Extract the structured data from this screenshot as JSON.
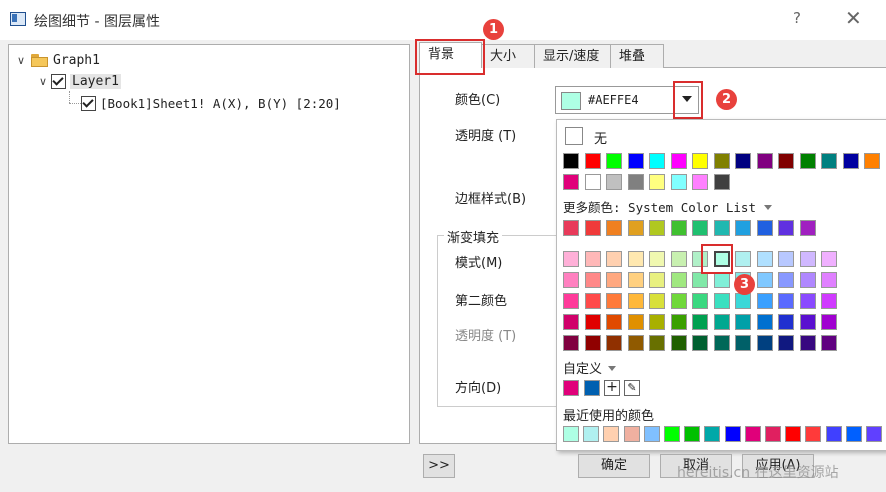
{
  "window": {
    "title": "绘图细节 - 图层属性",
    "help": "?",
    "close": "✕"
  },
  "tree": {
    "items": [
      {
        "label": "Graph1"
      },
      {
        "label": "Layer1"
      },
      {
        "label": "[Book1]Sheet1! A(X), B(Y) [2:20]"
      }
    ]
  },
  "tabs": [
    "背景",
    "大小",
    "显示/速度",
    "堆叠"
  ],
  "panel": {
    "color_label": "颜色(C)",
    "transparency_label": "透明度 (T)",
    "border_label": "边框样式(B)",
    "gradient_group": "渐变填充",
    "mode_label": "模式(M)",
    "second_color_label": "第二颜色",
    "gradient_transparency_label": "透明度 (T)",
    "direction_label": "方向(D)"
  },
  "color_combo": {
    "value": "#AEFFE4",
    "swatch_color": "#AEFFE4"
  },
  "popup": {
    "none_label": "无",
    "more_colors_label": "更多颜色: System Color List",
    "custom_label": "自定义",
    "recent_label": "最近使用的颜色",
    "basic_row1": [
      "#000000",
      "#ff0000",
      "#00ff00",
      "#0000ff",
      "#00ffff",
      "#ff00ff",
      "#ffff00",
      "#808000",
      "#000080",
      "#800080",
      "#800000",
      "#008000",
      "#008080",
      "#0000a0",
      "#ff8000",
      "#8000ff"
    ],
    "basic_row2": [
      "#e0007a",
      "#ffffff",
      "#c0c0c0",
      "#808080",
      "#ffff80",
      "#80ffff",
      "#ff80ff",
      "#404040"
    ],
    "system_row": [
      "#e83a5a",
      "#f03a3a",
      "#f08020",
      "#e0a020",
      "#b0c820",
      "#40c030",
      "#20c070",
      "#20b8b0",
      "#20a0e0",
      "#2060e0",
      "#6030e0",
      "#a020c0"
    ],
    "grid": [
      [
        "#ffb0d8",
        "#ffb8b8",
        "#ffd0b0",
        "#ffe8b0",
        "#f0f8b0",
        "#c8f0b0",
        "#b0f0c8",
        "#aeffe4",
        "#b0f0f0",
        "#b0e0ff",
        "#b8c8ff",
        "#d0b8ff",
        "#f0b0ff"
      ],
      [
        "#ff80c0",
        "#ff8888",
        "#ffa880",
        "#ffd080",
        "#e8f080",
        "#a0e880",
        "#80e8a8",
        "#80f0d8",
        "#80e8e8",
        "#80c8ff",
        "#8898ff",
        "#b088ff",
        "#e080ff"
      ],
      [
        "#ff3a9a",
        "#ff4a4a",
        "#ff7a3a",
        "#ffb83a",
        "#d8e03a",
        "#70d83a",
        "#3ad880",
        "#3ae0c0",
        "#3ad8d8",
        "#3aa0ff",
        "#5a6aff",
        "#8a4aff",
        "#d03aff"
      ],
      [
        "#d0006a",
        "#e00000",
        "#e04a00",
        "#e09000",
        "#a8b000",
        "#3aa000",
        "#00a050",
        "#00a890",
        "#00a0a8",
        "#0070d0",
        "#2030d0",
        "#5a10d0",
        "#a000d0"
      ],
      [
        "#800040",
        "#900000",
        "#903000",
        "#905a00",
        "#687000",
        "#206000",
        "#006030",
        "#006858",
        "#006068",
        "#004080",
        "#101880",
        "#380880",
        "#600080"
      ]
    ],
    "custom_colors": [
      "#e0007a",
      "#0060b0"
    ],
    "recent": [
      "#aeffe4",
      "#b0f0f0",
      "#ffd0b0",
      "#f0b0a0",
      "#80c0ff",
      "#00ff00",
      "#00c000",
      "#00a8a8",
      "#0000ff",
      "#e0007a",
      "#e02060",
      "#ff0000",
      "#ff3a3a",
      "#4040ff",
      "#0060ff",
      "#6040ff"
    ]
  },
  "markers": [
    "1",
    "2",
    "3"
  ],
  "buttons": {
    "expand": ">>",
    "ok": "确定",
    "cancel": "取消",
    "apply": "应用(A)"
  },
  "watermark": "hereitis.cn 在这里资源站"
}
